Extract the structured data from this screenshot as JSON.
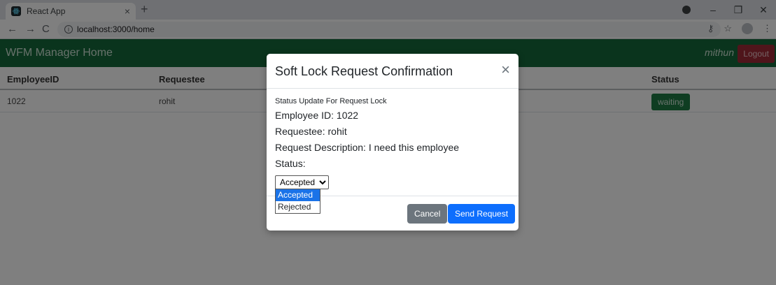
{
  "browser": {
    "tab_title": "React App",
    "tab_close": "×",
    "new_tab": "+",
    "url": "localhost:3000/home",
    "back": "←",
    "forward": "→",
    "reload": "C"
  },
  "nav": {
    "brand": "WFM Manager Home",
    "username": "mithun",
    "logout": "Logout"
  },
  "table": {
    "headers": {
      "employee_id": "EmployeeID",
      "requestee": "Requestee",
      "status": "Status"
    },
    "rows": [
      {
        "employee_id": "1022",
        "requestee": "rohit",
        "status": "waiting"
      }
    ]
  },
  "modal": {
    "title": "Soft Lock Request Confirmation",
    "close": "×",
    "subtitle": "Status Update For Request Lock",
    "employee_line": "Employee ID: 1022",
    "requestee_line": "Requestee: rohit",
    "description_line": "Request Description: I need this employee",
    "status_label": "Status:",
    "select_value": "Accepted",
    "options": [
      "Accepted",
      "Rejected"
    ],
    "cancel": "Cancel",
    "send": "Send Request"
  },
  "colors": {
    "navbar": "#15683a",
    "logout": "#9e2a36",
    "badge": "#1e7a44",
    "primary": "#0d6efd",
    "secondary": "#6c757d"
  }
}
